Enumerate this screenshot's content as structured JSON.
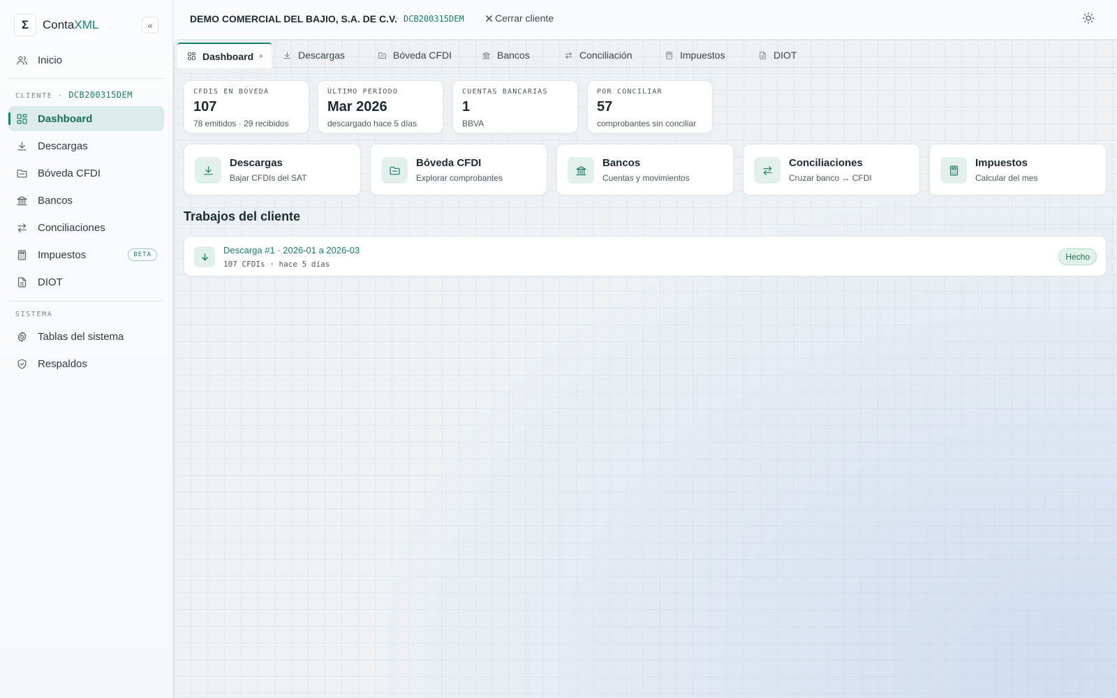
{
  "app": {
    "name_prefix": "Conta",
    "name_accent": "XML",
    "logo_glyph": "Σ",
    "collapse_glyph": "«"
  },
  "sidebar": {
    "home_label": "Inicio",
    "client_section_label": "CLIENTE ·",
    "client_rfc": "DCB200315DEM",
    "client_items": [
      {
        "label": "Dashboard",
        "icon": "dashboard-icon",
        "active": true
      },
      {
        "label": "Descargas",
        "icon": "download-icon"
      },
      {
        "label": "Bóveda CFDI",
        "icon": "folder-icon"
      },
      {
        "label": "Bancos",
        "icon": "bank-icon"
      },
      {
        "label": "Conciliaciones",
        "icon": "swap-icon"
      },
      {
        "label": "Impuestos",
        "icon": "calculator-icon",
        "badge": "BETA"
      },
      {
        "label": "DIOT",
        "icon": "document-icon"
      }
    ],
    "system_section_label": "SISTEMA",
    "system_items": [
      {
        "label": "Tablas del sistema",
        "icon": "gear-icon"
      },
      {
        "label": "Respaldos",
        "icon": "shield-icon"
      }
    ]
  },
  "header": {
    "client_name": "DEMO COMERCIAL DEL BAJIO, S.A. DE C.V.",
    "separator": "·",
    "client_rfc": "DCB200315DEM",
    "close_client_label": "Cerrar cliente"
  },
  "tabs": [
    {
      "label": "Dashboard",
      "icon": "dashboard-icon",
      "active": true,
      "close": "×"
    },
    {
      "label": "Descargas",
      "icon": "download-icon"
    },
    {
      "label": "Bóveda CFDI",
      "icon": "folder-icon"
    },
    {
      "label": "Bancos",
      "icon": "bank-icon"
    },
    {
      "label": "Conciliación",
      "icon": "swap-icon"
    },
    {
      "label": "Impuestos",
      "icon": "calculator-icon"
    },
    {
      "label": "DIOT",
      "icon": "document-icon"
    }
  ],
  "stats": [
    {
      "label": "CFDIS EN BÓVEDA",
      "value": "107",
      "sub": "78 emitidos · 29 recibidos"
    },
    {
      "label": "ÚLTIMO PERÍODO",
      "value": "Mar 2026",
      "sub": "descargado hace 5 días"
    },
    {
      "label": "CUENTAS BANCARIAS",
      "value": "1",
      "sub": "BBVA"
    },
    {
      "label": "POR CONCILIAR",
      "value": "57",
      "sub": "comprobantes sin conciliar"
    }
  ],
  "quick_links": [
    {
      "title": "Descargas",
      "sub": "Bajar CFDIs del SAT",
      "icon": "download-icon"
    },
    {
      "title": "Bóveda CFDI",
      "sub": "Explorar comprobantes",
      "icon": "folder-icon"
    },
    {
      "title": "Bancos",
      "sub": "Cuentas y movimientos",
      "icon": "bank-icon"
    },
    {
      "title": "Conciliaciones",
      "sub": "Cruzar banco ↔ CFDI",
      "icon": "swap-icon"
    },
    {
      "title": "Impuestos",
      "sub": "Calcular del mes",
      "icon": "calculator-icon"
    }
  ],
  "jobs": {
    "section_title": "Trabajos del cliente",
    "items": [
      {
        "title": "Descarga #1 · 2026-01 a 2026-03",
        "meta": "107 CFDIs · hace 5 días",
        "status": "Hecho",
        "icon": "arrow-down-icon"
      }
    ]
  },
  "colors": {
    "accent": "#1b7d68",
    "active_bg": "#dcebe7",
    "status_bg": "#e1f2ea"
  }
}
